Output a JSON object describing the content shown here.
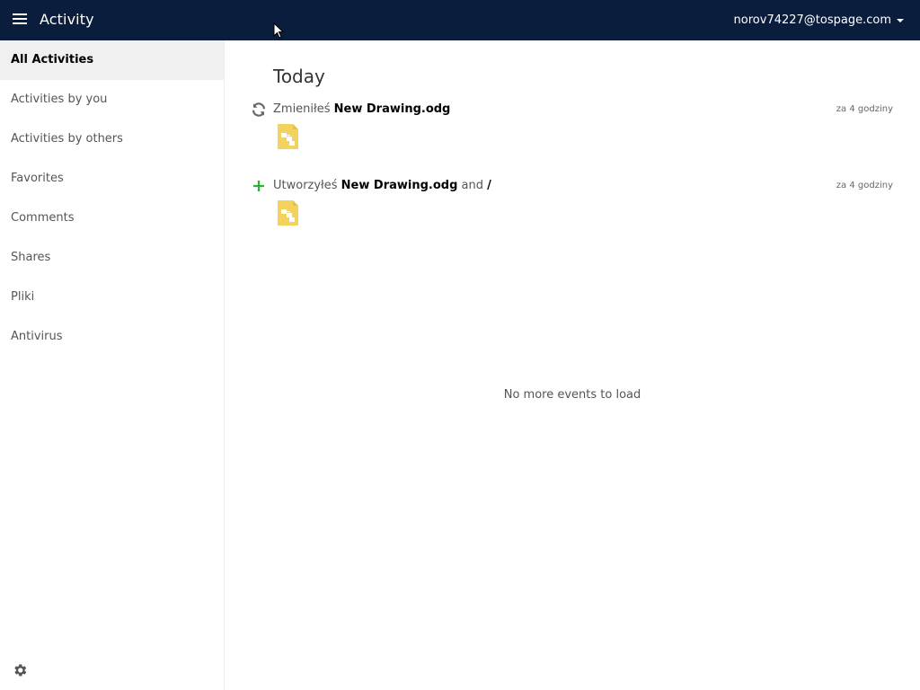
{
  "header": {
    "app_title": "Activity",
    "user_email": "norov74227@tospage.com"
  },
  "sidebar": {
    "items": [
      {
        "label": "All Activities",
        "active": true
      },
      {
        "label": "Activities by you"
      },
      {
        "label": "Activities by others"
      },
      {
        "label": "Favorites"
      },
      {
        "label": "Comments"
      },
      {
        "label": "Shares"
      },
      {
        "label": "Pliki"
      },
      {
        "label": "Antivirus"
      }
    ]
  },
  "main": {
    "section_title": "Today",
    "activities": [
      {
        "icon": "refresh-icon",
        "verb": "Zmieniłeś",
        "file": "New Drawing.odg",
        "connector": "",
        "target": "",
        "time": "za 4 godziny",
        "preview_icon": "drawing-file-icon"
      },
      {
        "icon": "plus-icon",
        "verb": "Utworzyłeś",
        "file": "New Drawing.odg",
        "connector": "and",
        "target": "/",
        "time": "za 4 godziny",
        "preview_icon": "drawing-file-icon"
      }
    ],
    "no_more": "No more events to load"
  },
  "colors": {
    "header_bg": "#0b1d3c",
    "create_green": "#2fb130",
    "file_yellow": "#f1d35d"
  }
}
